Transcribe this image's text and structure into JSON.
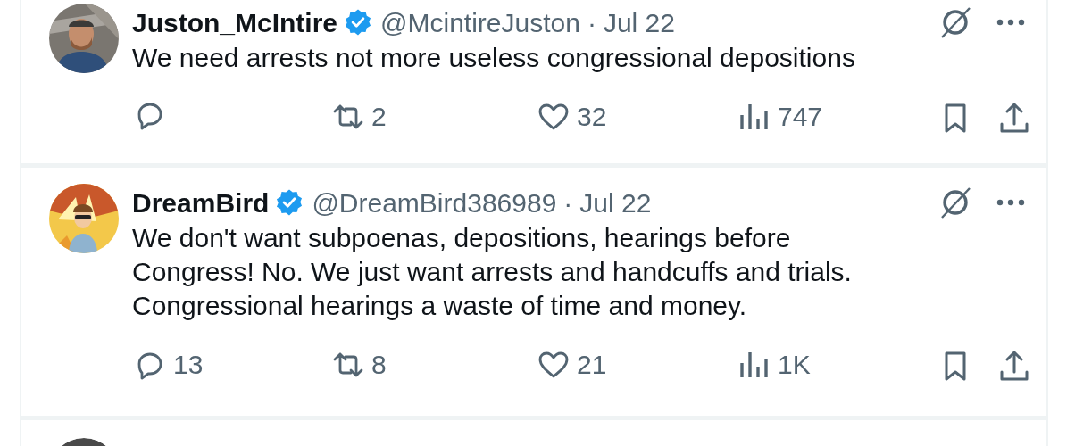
{
  "tweets": [
    {
      "name": "Juston_McIntire",
      "verified": true,
      "handle": "@McintireJuston",
      "separator": "·",
      "date": "Jul 22",
      "avatar": {
        "kind": "picture"
      },
      "text": "We need arrests not more useless congressional depositions",
      "actions": {
        "views": "747",
        "retweets": "2",
        "likes": "32"
      }
    },
    {
      "name": "DreamBird",
      "verified": true,
      "handle": "@DreamBird386989",
      "separator": "·",
      "date": "Jul 22",
      "avatar": {
        "kind": "picture"
      },
      "text": "We don't want subpoenas, depositions, hearings before Congress! No. We just want arrests and handcuffs and trials. Congressional hearings a waste of time and money.",
      "actions": {
        "views": "1K",
        "replies": "13",
        "retweets": "8",
        "likes": "21"
      }
    },
    {
      "avatar": {
        "kind": "picture"
      }
    }
  ]
}
